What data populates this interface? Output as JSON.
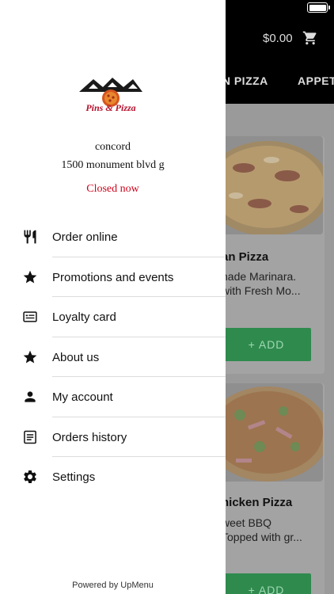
{
  "status_bar": {
    "battery_icon": "battery-icon"
  },
  "header": {
    "cart_total": "$0.00",
    "cart_icon": "cart-icon",
    "category_tabs": [
      "YN PIZZA",
      "APPET"
    ]
  },
  "menu_cards": [
    {
      "title": "an Pizza",
      "desc_line1": "nade Marinara.",
      "desc_line2": "with Fresh Mo...",
      "add_label": "+ ADD"
    },
    {
      "title": "hicken Pizza",
      "desc_line1": "weet BBQ",
      "desc_line2": "Topped with gr...",
      "add_label": "+ ADD"
    }
  ],
  "drawer": {
    "logo_text": "Pins & Pizza",
    "location_name": "concord",
    "location_address": "1500 monument blvd g",
    "location_status": "Closed now",
    "items": [
      {
        "label": "Order online",
        "icon": "fork-knife-icon"
      },
      {
        "label": "Promotions and events",
        "icon": "star-icon"
      },
      {
        "label": "Loyalty card",
        "icon": "card-icon"
      },
      {
        "label": "About us",
        "icon": "star-icon"
      },
      {
        "label": "My account",
        "icon": "person-icon"
      },
      {
        "label": "Orders history",
        "icon": "list-icon"
      },
      {
        "label": "Settings",
        "icon": "gear-icon"
      }
    ],
    "powered_by": "Powered by UpMenu"
  },
  "colors": {
    "status_closed": "#d0021b",
    "add_button": "#2f8a4e",
    "topbar": "#000000"
  }
}
